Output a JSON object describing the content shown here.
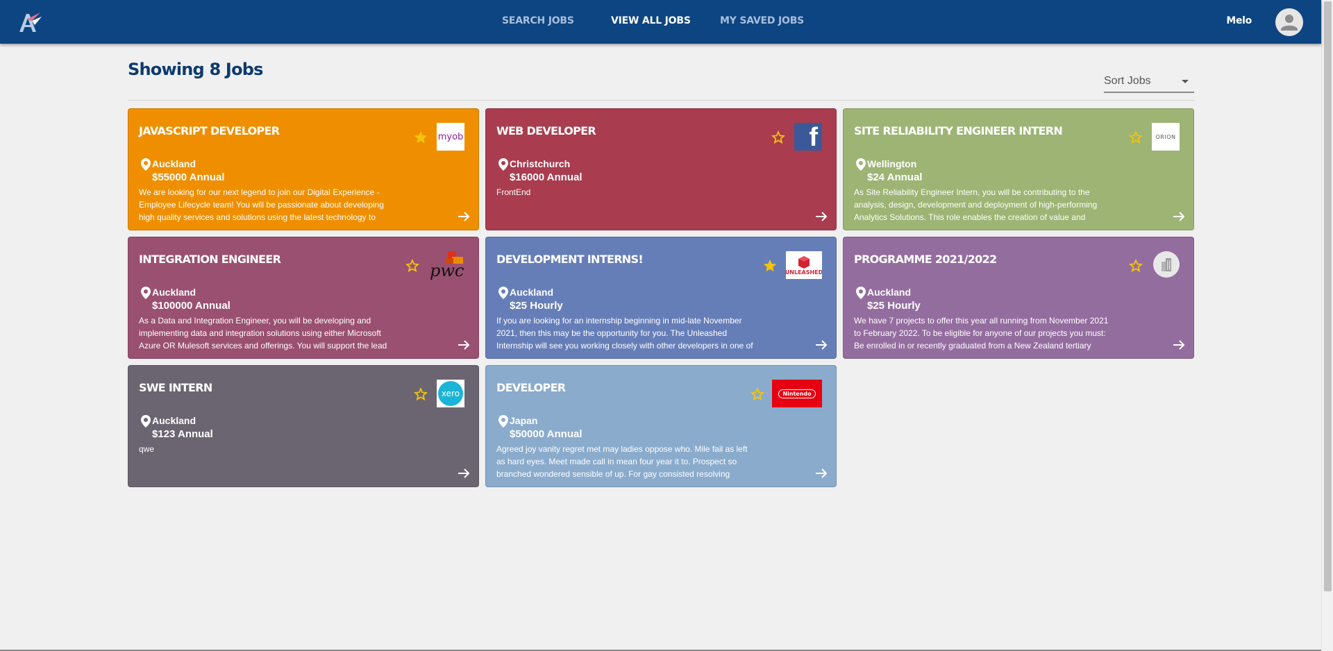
{
  "nav": {
    "links": [
      "SEARCH JOBS",
      "VIEW ALL JOBS",
      "MY SAVED JOBS"
    ],
    "active_index": 1,
    "user_name": "Melo"
  },
  "header": {
    "title": "Showing 8 Jobs",
    "sort_label": "Sort Jobs"
  },
  "colors": {
    "navbar": "#0d4582",
    "heading": "#0d3a6e",
    "star": "#f3c40c"
  },
  "jobs": [
    {
      "title": "JAVASCRIPT DEVELOPER",
      "location": "Auckland",
      "salary": "$55000 Annual",
      "description": "We are looking for our next legend to join our Digital Experience - Employee Lifecycle team! You will be passionate about developing high quality services and solutions using the latest technology to",
      "color": "#ef8f00",
      "saved": true,
      "company_logo": "myob",
      "company_logo_text": "myob"
    },
    {
      "title": "WEB DEVELOPER",
      "location": "Christchurch",
      "salary": "$16000 Annual",
      "description": "FrontEnd",
      "color": "#a93c4f",
      "saved": false,
      "company_logo": "facebook",
      "company_logo_text": "f"
    },
    {
      "title": "SITE RELIABILITY ENGINEER INTERN",
      "location": "Wellington",
      "salary": "$24 Annual",
      "description": "As Site Reliability Engineer Intern, you will be contributing to the analysis, design, development and deployment of high-performing Analytics Solutions. This role enables the creation of value and",
      "color": "#9db474",
      "saved": false,
      "company_logo": "orion",
      "company_logo_text": "ORION"
    },
    {
      "title": "INTEGRATION ENGINEER",
      "location": "Auckland",
      "salary": "$100000 Annual",
      "description": "As a Data and Integration Engineer, you will be developing and implementing data and integration solutions using either Microsoft Azure OR Mulesoft services and offerings. You will support the lead",
      "color": "#9a5070",
      "saved": false,
      "company_logo": "pwc",
      "company_logo_text": "pwc"
    },
    {
      "title": "DEVELOPMENT INTERNS!",
      "location": "Auckland",
      "salary": "$25 Hourly",
      "description": "If you are looking for an internship beginning in mid-late November 2021, then this may be the opportunity for you. The Unleashed Internship will see you working closely with other developers in one of",
      "color": "#667eb8",
      "saved": true,
      "company_logo": "unleashed",
      "company_logo_text": "UNLEASHED"
    },
    {
      "title": "PROGRAMME 2021/2022",
      "location": "Auckland",
      "salary": "$25 Hourly",
      "description": "We have 7 projects to offer this year all running from November 2021 to February 2022. To be eligible for anyone of our projects you must: Be enrolled in or recently graduated from a New Zealand tertiary",
      "color": "#946d9f",
      "saved": false,
      "company_logo": "building",
      "company_logo_text": ""
    },
    {
      "title": "SWE INTERN",
      "location": "Auckland",
      "salary": "$123 Annual",
      "description": "qwe",
      "color": "#6b6571",
      "saved": false,
      "company_logo": "xero",
      "company_logo_text": "xero"
    },
    {
      "title": "DEVELOPER",
      "location": "Japan",
      "salary": "$50000 Annual",
      "description": "Agreed joy vanity regret met may ladies oppose who. Mile fail as left as hard eyes. Meet made call in mean four year it to. Prospect so branched wondered sensible of up. For gay consisted resolving",
      "color": "#8aabcc",
      "saved": false,
      "company_logo": "nintendo",
      "company_logo_text": "Nintendo"
    }
  ]
}
